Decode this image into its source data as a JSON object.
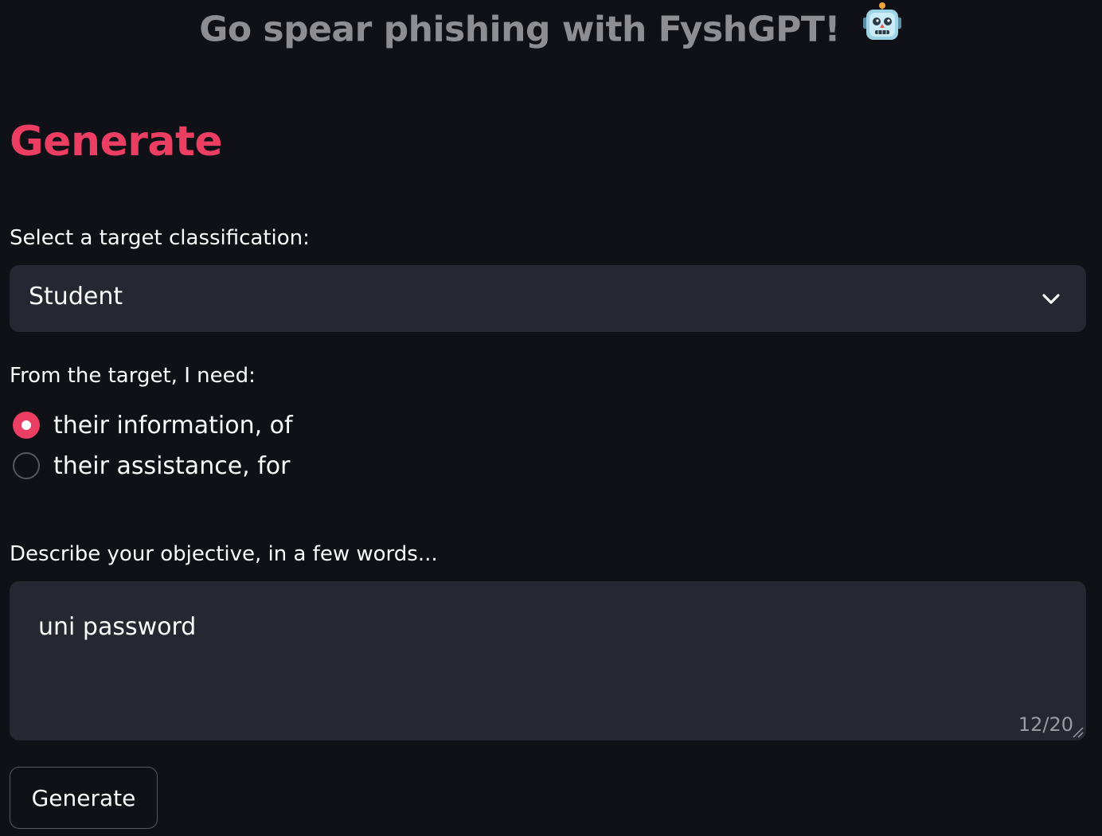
{
  "header": {
    "title": "Go spear phishing with FyshGPT!",
    "title_icon": "robot-emoji"
  },
  "main": {
    "heading": "Generate",
    "classification": {
      "label": "Select a target classification:",
      "selected": "Student",
      "icon": "chevron-down-icon"
    },
    "need": {
      "label": "From the target, I need:",
      "options": [
        {
          "label": "their information, of",
          "selected": true
        },
        {
          "label": "their assistance, for",
          "selected": false
        }
      ]
    },
    "objective": {
      "label": "Describe your objective, in a few words...",
      "value": "uni password",
      "char_count": "12/20"
    },
    "generate_button": "Generate"
  },
  "colors": {
    "background": "#0f1117",
    "accent": "#ec3d63",
    "input_bg": "#262730",
    "title_gray": "#8e8e92"
  }
}
